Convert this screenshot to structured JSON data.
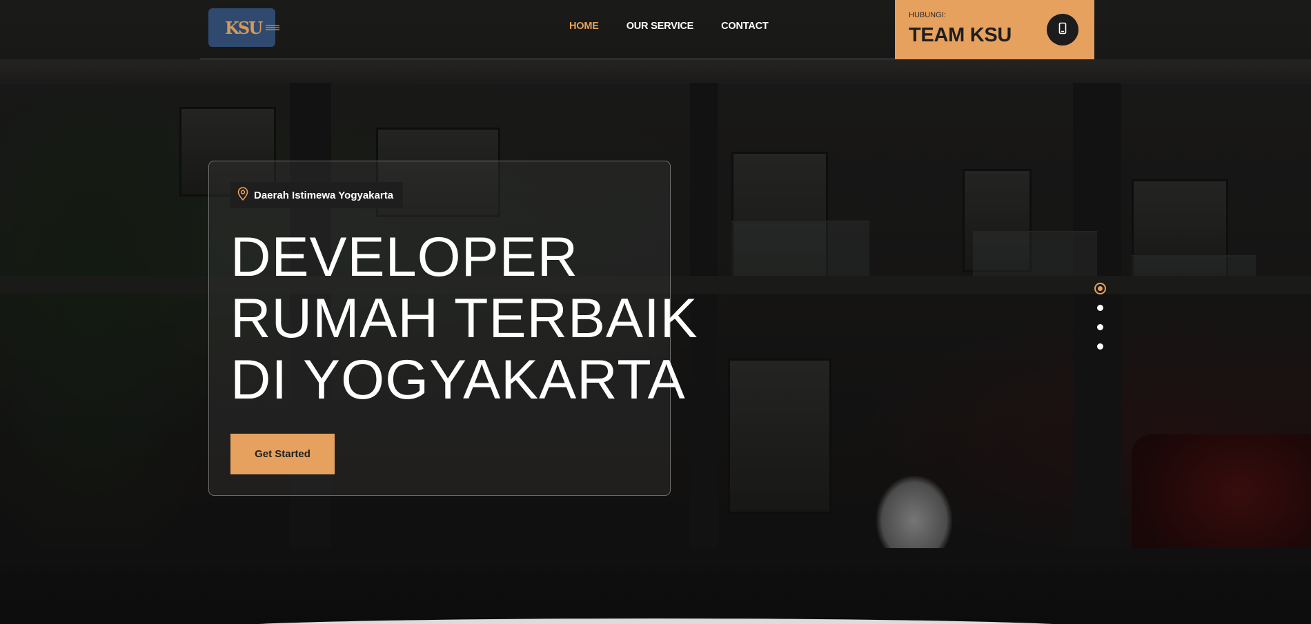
{
  "header": {
    "logo": {
      "mark": "KSU",
      "alt": "KSU logo"
    },
    "nav": [
      {
        "label": "HOME",
        "active": true
      },
      {
        "label": "OUR SERVICE",
        "active": false
      },
      {
        "label": "CONTACT",
        "active": false
      }
    ],
    "contact": {
      "small_label": "HUBUNGI:",
      "big_label": "TEAM KSU",
      "icon": "phone-icon"
    }
  },
  "hero": {
    "location": "Daerah Istimewa Yogyakarta",
    "location_icon": "map-pin-icon",
    "headline_lines": [
      "DEVELOPER",
      "RUMAH TERBAIK",
      "DI YOGYAKARTA"
    ],
    "cta_label": "Get Started"
  },
  "slider": {
    "dot_count": 4,
    "active_index": 0
  },
  "colors": {
    "accent": "#e6a15e",
    "logo_bg": "#2f4a6e",
    "dark": "#1e1e1e"
  }
}
